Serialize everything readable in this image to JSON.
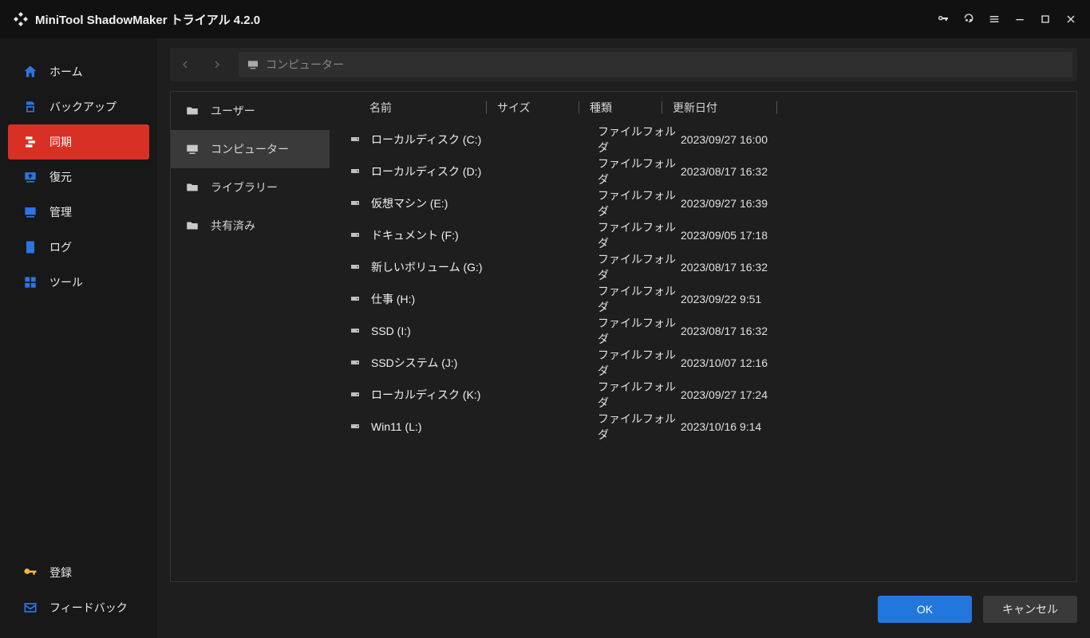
{
  "titlebar": {
    "title": "MiniTool ShadowMaker トライアル 4.2.0"
  },
  "sidebar": {
    "items": [
      {
        "label": "ホーム"
      },
      {
        "label": "バックアップ"
      },
      {
        "label": "同期"
      },
      {
        "label": "復元"
      },
      {
        "label": "管理"
      },
      {
        "label": "ログ"
      },
      {
        "label": "ツール"
      }
    ],
    "register": "登録",
    "feedback": "フィードバック"
  },
  "path": {
    "label": "コンピューター"
  },
  "quick": {
    "items": [
      {
        "label": "ユーザー"
      },
      {
        "label": "コンピューター"
      },
      {
        "label": "ライブラリー"
      },
      {
        "label": "共有済み"
      }
    ]
  },
  "columns": {
    "name": "名前",
    "size": "サイズ",
    "type": "種類",
    "date": "更新日付"
  },
  "rows": [
    {
      "name": "ローカルディスク (C:)",
      "type": "ファイルフォルダ",
      "date": "2023/09/27 16:00"
    },
    {
      "name": "ローカルディスク (D:)",
      "type": "ファイルフォルダ",
      "date": "2023/08/17 16:32"
    },
    {
      "name": "仮想マシン (E:)",
      "type": "ファイルフォルダ",
      "date": "2023/09/27 16:39"
    },
    {
      "name": "ドキュメント (F:)",
      "type": "ファイルフォルダ",
      "date": "2023/09/05 17:18"
    },
    {
      "name": "新しいボリューム (G:)",
      "type": "ファイルフォルダ",
      "date": "2023/08/17 16:32"
    },
    {
      "name": "仕事 (H:)",
      "type": "ファイルフォルダ",
      "date": "2023/09/22 9:51"
    },
    {
      "name": "SSD (I:)",
      "type": "ファイルフォルダ",
      "date": "2023/08/17 16:32"
    },
    {
      "name": "SSDシステム (J:)",
      "type": "ファイルフォルダ",
      "date": "2023/10/07 12:16"
    },
    {
      "name": "ローカルディスク (K:)",
      "type": "ファイルフォルダ",
      "date": "2023/09/27 17:24"
    },
    {
      "name": "Win11 (L:)",
      "type": "ファイルフォルダ",
      "date": "2023/10/16 9:14"
    }
  ],
  "buttons": {
    "ok": "OK",
    "cancel": "キャンセル"
  }
}
